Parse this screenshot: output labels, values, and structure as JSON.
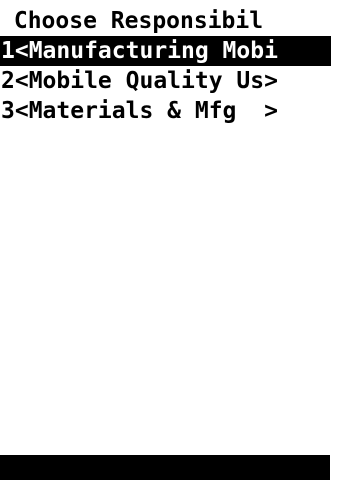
{
  "screen": {
    "title": " Choose Responsibil",
    "menu_items": [
      {
        "label": "1<Manufacturing Mobi"
      },
      {
        "label": "2<Mobile Quality Us>"
      },
      {
        "label": "3<Materials & Mfg  >"
      }
    ],
    "colors": {
      "background": "#ffffff",
      "text": "#000000",
      "highlight_background": "#000000",
      "highlight_text": "#ffffff"
    }
  }
}
